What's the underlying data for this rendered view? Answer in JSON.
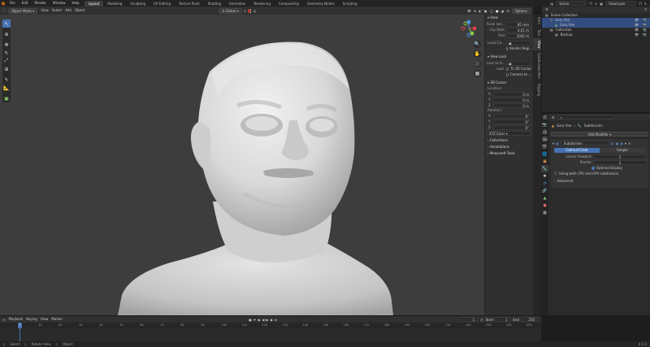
{
  "topbar": {
    "menus": [
      "File",
      "Edit",
      "Render",
      "Window",
      "Help"
    ],
    "workspaces": [
      "Layout",
      "Modeling",
      "Sculpting",
      "UV Editing",
      "Texture Paint",
      "Shading",
      "Animation",
      "Rendering",
      "Compositing",
      "Geometry Nodes",
      "Scripting"
    ],
    "active_workspace": "Layout",
    "scene_label": "Scene",
    "viewlayer_label": "ViewLayer"
  },
  "viewport_header": {
    "mode": "Object Mode",
    "menus": [
      "View",
      "Select",
      "Add",
      "Object"
    ],
    "transform_orientation": "Global",
    "options_label": "Options"
  },
  "npanel": {
    "tabs": [
      "Item",
      "Tool",
      "View",
      "Subdivision Nav",
      "Rigging"
    ],
    "active_tab": "View",
    "view_section": "View",
    "focal_length_label": "Focal Len...",
    "focal_length_value": "85 mm",
    "clip_start_label": "Clip Start",
    "clip_start_value": "0.01 m",
    "clip_end_label": "End",
    "clip_end_value": "1000 m",
    "local_camera_label": "Local Ca...",
    "render_region_label": "Render Regi...",
    "view_lock_section": "View Lock",
    "lock_to_object_label": "Lock to O...",
    "lock_label": "Lock",
    "lock_to_3d_cursor": "To 3D Cursor",
    "lock_camera_to_view": "Camera to ...",
    "cursor_section": "3D Cursor",
    "location_label": "Location:",
    "location": [
      {
        "axis": "X",
        "value": "0 m"
      },
      {
        "axis": "Y",
        "value": "0 m"
      },
      {
        "axis": "Z",
        "value": "0 m"
      }
    ],
    "rotation_label": "Rotation:",
    "rotation": [
      {
        "axis": "X",
        "value": "0°"
      },
      {
        "axis": "Y",
        "value": "0°"
      },
      {
        "axis": "Z",
        "value": "0°"
      }
    ],
    "rotation_mode": "XYZ Euler",
    "collections_section": "Collections",
    "annotations_section": "Annotations",
    "measureit_section": "MeasureIt Tools"
  },
  "outliner": {
    "root": "Scene Collection",
    "items": [
      {
        "name": "Gary Vee",
        "indent": 1,
        "icon": "object-icon"
      },
      {
        "name": "Gary Vee",
        "indent": 2,
        "icon": "mesh-icon"
      },
      {
        "name": "Collection",
        "indent": 1,
        "icon": "collection-icon"
      },
      {
        "name": "Backup",
        "indent": 2,
        "icon": "collection-icon"
      }
    ]
  },
  "properties": {
    "breadcrumb_object": "Gary Vee",
    "breadcrumb_modifier": "Subdivision",
    "add_modifier_label": "Add Modifier",
    "modifier_name": "Subdivision",
    "mode_catmull": "Catmull-Clark",
    "mode_simple": "Simple",
    "levels_viewport_label": "Levels Viewport",
    "levels_viewport_value": "2",
    "render_label": "Render",
    "render_value": "2",
    "optimal_display_label": "Optimal Display",
    "gpu_label": "Using both CPU and GPU subdivision",
    "advanced_label": "Advanced"
  },
  "timeline": {
    "menus": [
      "Playback",
      "Keying",
      "View",
      "Marker"
    ],
    "current_frame": "1",
    "start_label": "Start",
    "start_value": "1",
    "end_label": "End",
    "end_value": "250",
    "ticks": [
      "0",
      "10",
      "20",
      "30",
      "40",
      "50",
      "60",
      "70",
      "80",
      "90",
      "100",
      "110",
      "120",
      "130",
      "140",
      "150",
      "160",
      "170",
      "180",
      "190",
      "200",
      "210",
      "220",
      "230",
      "240",
      "250"
    ]
  },
  "statusbar": {
    "select": "Select",
    "rotate_view": "Rotate View",
    "object": "Object",
    "version": "4.1.0"
  },
  "colors": {
    "accent": "#4772b3",
    "selected_row": "#334d80",
    "viewport_bg": "#3d3d3d",
    "blender_orange": "#e87d0d"
  }
}
